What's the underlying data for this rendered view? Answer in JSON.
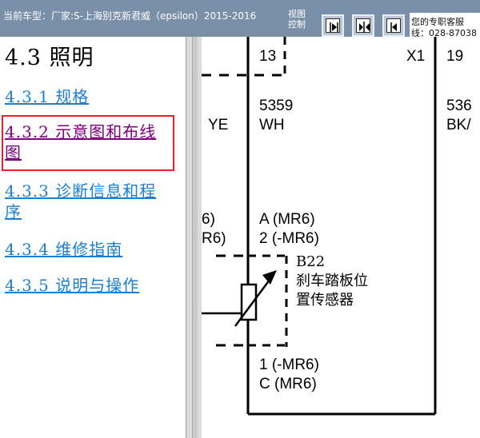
{
  "header": {
    "vehicle_text": "当前车型：厂家:S-上海别克新君威（epsilon）2015-2016",
    "view_control_label": "视图控制",
    "nav_buttons": [
      "next-page-icon",
      "split-view-icon",
      "previous-page-icon"
    ],
    "service_line1": "您的专职客服",
    "service_line2": "线：028-87038"
  },
  "toc": {
    "title": "4.3 照明",
    "items": [
      {
        "label": "4.3.1 规格"
      },
      {
        "label": "4.3.2 示意图和布线图"
      },
      {
        "label": "4.3.3 诊断信息和程序"
      },
      {
        "label": "4.3.4 维修指南"
      },
      {
        "label": "4.3.5 说明与操作"
      }
    ],
    "selected_index": 1
  },
  "diagram": {
    "pin_13": "13",
    "connector_x1": "X1",
    "pin_19": "19",
    "wire_5359": "5359",
    "wire_wh": "WH",
    "wire_536": "536",
    "wire_bk": "BK/",
    "wire_ye": "YE",
    "left_mr6_top": "6)",
    "left_mr6_bottom": "R6)",
    "pin_a": "A (MR6)",
    "pin_2": "2 (-MR6)",
    "component_id": "B22",
    "component_name_1": "刹车踏板位",
    "component_name_2": "置传感器",
    "pin_1": "1 (-MR6)",
    "pin_c": "C (MR6)"
  }
}
